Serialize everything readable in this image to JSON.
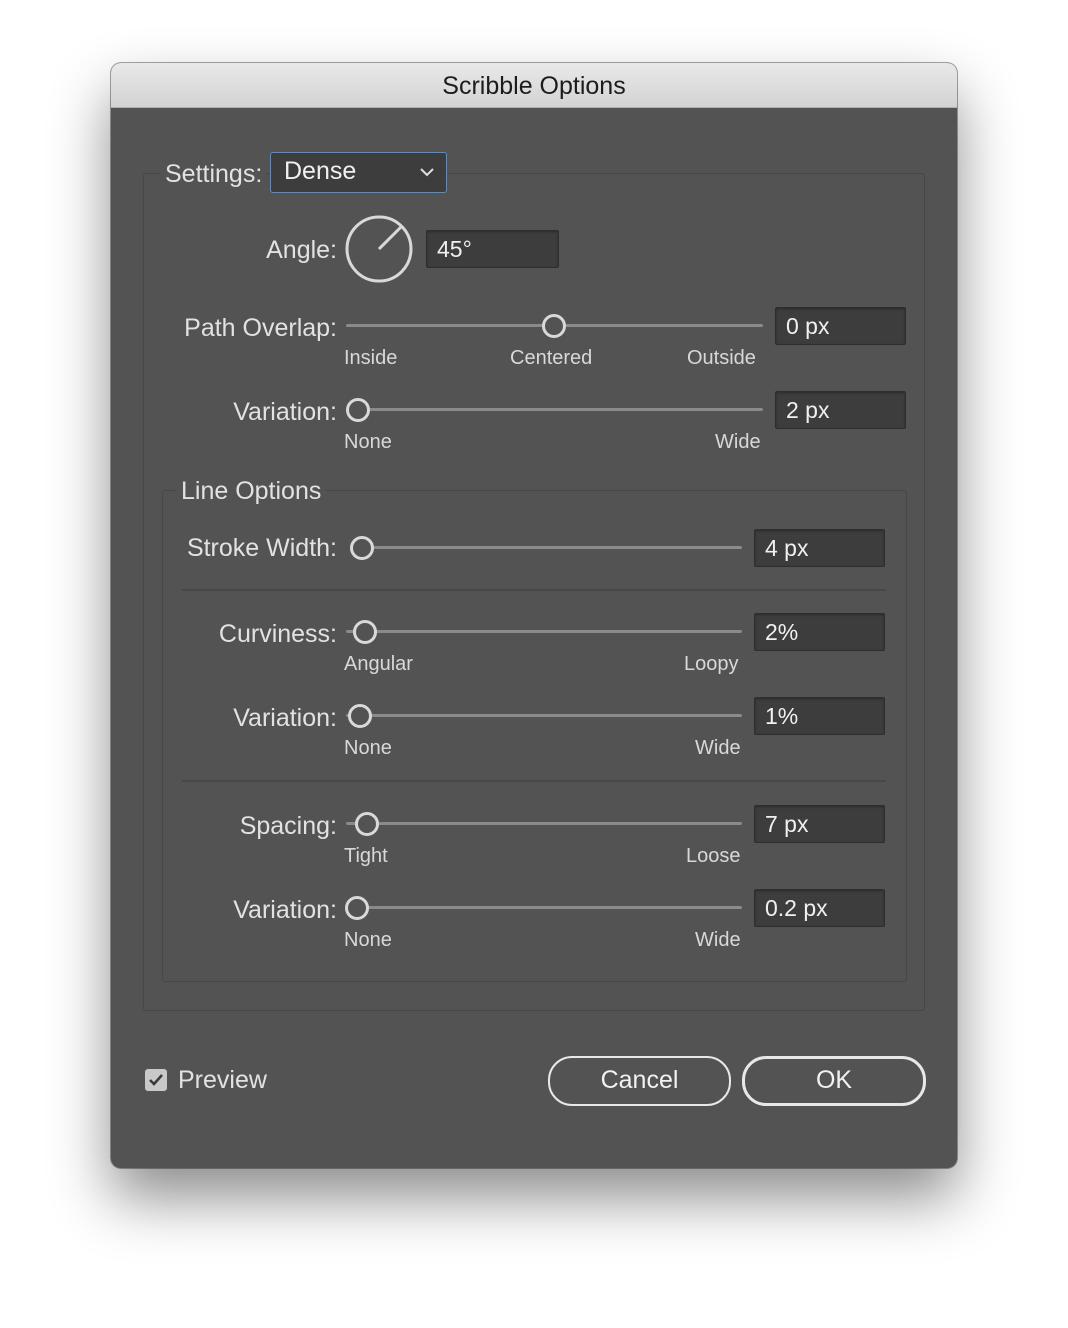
{
  "dialog": {
    "title": "Scribble Options"
  },
  "settings": {
    "label": "Settings:",
    "value": "Dense"
  },
  "angle": {
    "label": "Angle:",
    "value": "45°"
  },
  "path_overlap": {
    "label": "Path Overlap:",
    "value": "0 px",
    "min_label": "Inside",
    "mid_label": "Centered",
    "max_label": "Outside",
    "level": 0.5
  },
  "path_variation": {
    "label": "Variation:",
    "value": "2 px",
    "min_label": "None",
    "max_label": "Wide",
    "level": 0.0
  },
  "line_options": {
    "title": "Line Options",
    "stroke_width": {
      "label": "Stroke Width:",
      "value": "4 px",
      "level": 0.0
    },
    "curviness": {
      "label": "Curviness:",
      "value": "2%",
      "min_label": "Angular",
      "max_label": "Loopy",
      "level": 0.02
    },
    "curviness_variation": {
      "label": "Variation:",
      "value": "1%",
      "min_label": "None",
      "max_label": "Wide",
      "level": 0.01
    },
    "spacing": {
      "label": "Spacing:",
      "value": "7 px",
      "min_label": "Tight",
      "max_label": "Loose",
      "level": 0.03
    },
    "spacing_variation": {
      "label": "Variation:",
      "value": "0.2 px",
      "min_label": "None",
      "max_label": "Wide",
      "level": 0.0
    }
  },
  "preview": {
    "label": "Preview",
    "checked": true
  },
  "buttons": {
    "cancel": "Cancel",
    "ok": "OK"
  },
  "colors": {
    "dialog_bg": "#535353",
    "field_bg": "#3d3d3d",
    "accent": "#4a90e2"
  }
}
